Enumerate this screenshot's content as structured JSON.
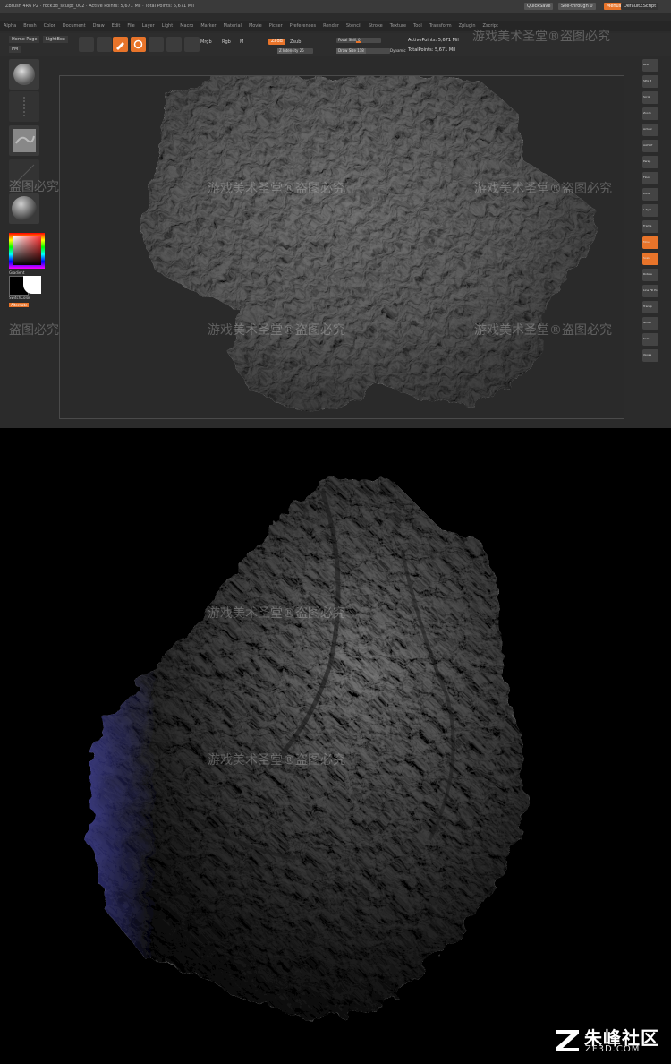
{
  "titlebar": {
    "title": "ZBrush 4R6 P2 · rock3d_sculpt_002 · Active Points: 5,671 Mil · Total Points: 5,671 Mil",
    "quicksave": "QuickSave",
    "seethrough": "See-through 0",
    "menus_label": "Menus",
    "script": "DefaultZScript"
  },
  "menubar": {
    "items": [
      "Alpha",
      "Brush",
      "Color",
      "Document",
      "Draw",
      "Edit",
      "File",
      "Layer",
      "Light",
      "Macro",
      "Marker",
      "Material",
      "Movie",
      "Picker",
      "Preferences",
      "Render",
      "Stencil",
      "Stroke",
      "Texture",
      "Tool",
      "Transform",
      "Zplugin",
      "Zscript"
    ]
  },
  "toolbar": {
    "home_label": "Home Page",
    "lightbox_label": "LightBox",
    "edit_label": "Edit",
    "draw_label": "Draw",
    "move_label": "Move",
    "scale_label": "Scale",
    "rotate_label": "Rotate",
    "mrgb_label": "Mrgb",
    "rgb_label": "Rgb",
    "m_label": "M",
    "zadd_label": "Zadd",
    "zsub_label": "Zsub",
    "focal_label": "Focal Shift 0",
    "draw_size_label": "Draw Size 118",
    "z_intensity_label": "Z Intensity 25",
    "dynamic_label": "Dynamic",
    "active_points": "ActivePoints: 5,671 Mil",
    "total_points": "TotalPoints: 5,671 Mil"
  },
  "left_tray": {
    "material_label": "SkinShade4",
    "gradient_label": "Gradient",
    "switch_label": "SwitchColor",
    "alternate_label": "Alternate"
  },
  "right_tray": {
    "buttons": [
      "BPR",
      "SPix 3",
      "Scroll",
      "Zoom",
      "Actual",
      "AAHalf",
      "Persp",
      "Floor",
      "Local",
      "L.Sym",
      "Frame",
      "Move",
      "Scale",
      "Rotate",
      "Line Fill PolyF",
      "Transp",
      "Ghost",
      "Solo",
      "Xpose"
    ]
  },
  "watermarks": {
    "text": "游戏美术圣堂®盗图必究",
    "text_short": "盗图必究"
  },
  "logo": {
    "chinese": "朱峰社区",
    "domain": "ZF3D.COM"
  },
  "colors": {
    "accent": "#e8742a",
    "ui_bg": "#2b2b2b",
    "render_bg": "#000000"
  }
}
